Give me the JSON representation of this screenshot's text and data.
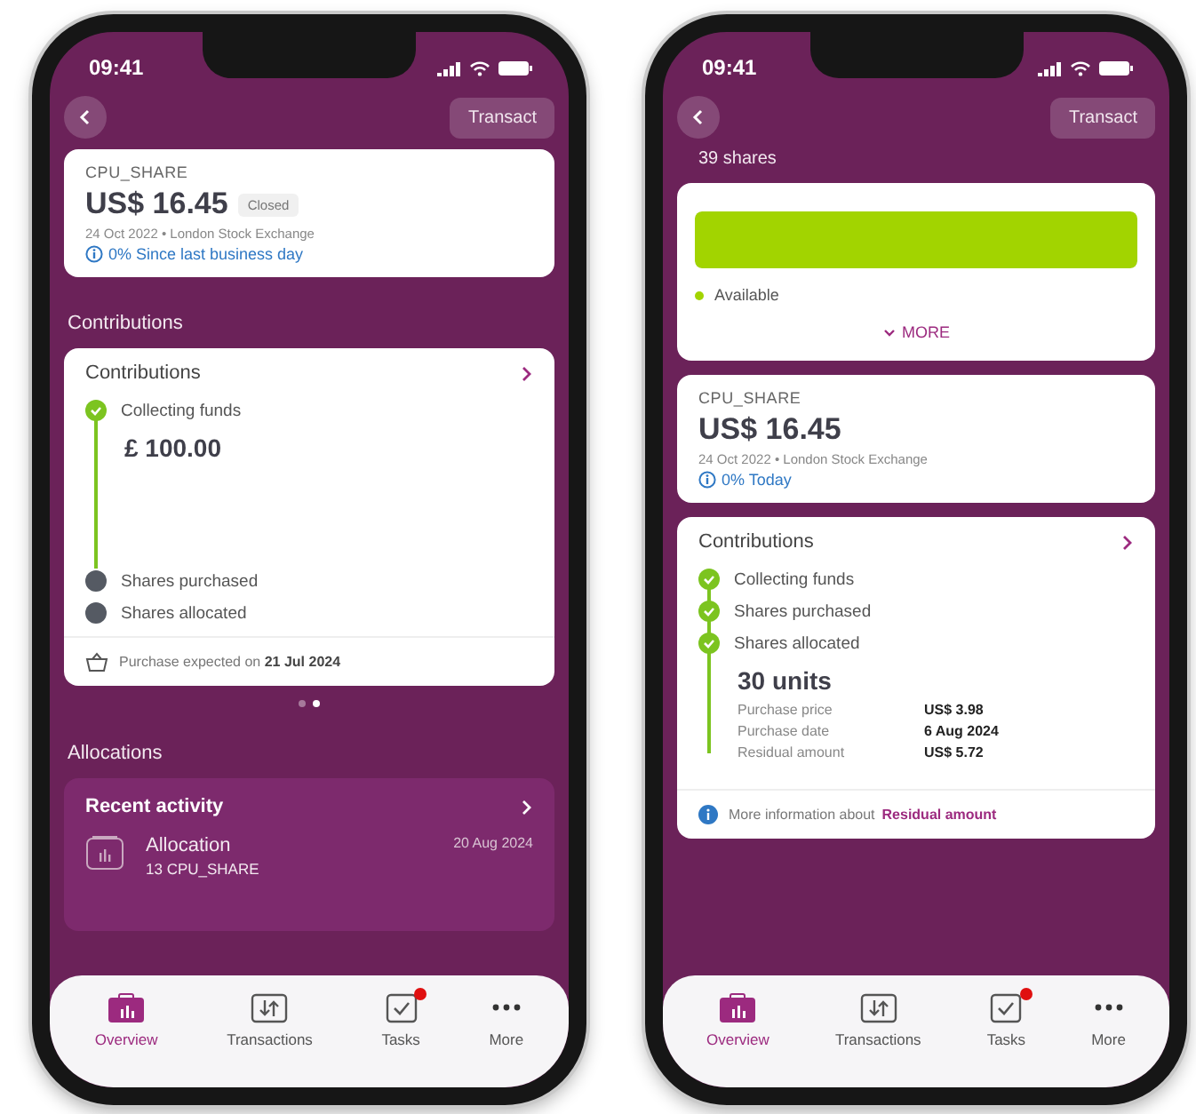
{
  "phones": [
    {
      "status": {
        "time": "09:41"
      },
      "header": {
        "action": "Transact"
      },
      "blocks": [
        {
          "kind": "price",
          "symbol": "CPU_SHARE",
          "price": "US$ 16.45",
          "badge": "Closed",
          "meta": "24 Oct 2022 • London Stock Exchange",
          "change": "0% Since last business day"
        },
        {
          "kind": "heading",
          "text": "Contributions"
        },
        {
          "kind": "contributions",
          "title": "Contributions",
          "steps": [
            {
              "label": "Collecting funds",
              "done": true,
              "detail": "£ 100.00"
            },
            {
              "label": "Shares purchased",
              "done": false
            },
            {
              "label": "Shares allocated",
              "done": false
            }
          ],
          "footer": {
            "kind": "basket",
            "text": "Purchase expected on **21 Jul 2024**"
          }
        },
        {
          "kind": "pager",
          "dots": [
            {
              "selected": false
            },
            {
              "selected": true
            }
          ]
        },
        {
          "kind": "heading",
          "text": "Allocations"
        },
        {
          "kind": "activity",
          "title": "Recent activity",
          "item": {
            "title": "Allocation",
            "date": "20 Aug 2024",
            "subtitle": "13 CPU_SHARE"
          }
        }
      ],
      "nav": [
        {
          "label": "Overview",
          "kind": "overview",
          "selected": true,
          "alert": false
        },
        {
          "label": "Transactions",
          "kind": "transactions",
          "selected": false,
          "alert": false
        },
        {
          "label": "Tasks",
          "kind": "tasks",
          "selected": false,
          "alert": true
        },
        {
          "label": "More",
          "kind": "more",
          "selected": false,
          "alert": false
        }
      ]
    },
    {
      "status": {
        "time": "09:41"
      },
      "header": {
        "action": "Transact"
      },
      "blocks": [
        {
          "kind": "subheading",
          "text": "39 shares"
        },
        {
          "kind": "availability",
          "level": 1,
          "legend": "Available",
          "more": "MORE"
        },
        {
          "kind": "price",
          "symbol": "CPU_SHARE",
          "price": "US$ 16.45",
          "meta": "24 Oct 2022 • London Stock Exchange",
          "change": "0% Today"
        },
        {
          "kind": "contributions",
          "title": "Contributions",
          "steps": [
            {
              "label": "Collecting funds",
              "done": true
            },
            {
              "label": "Shares purchased",
              "done": true
            },
            {
              "label": "Shares allocated",
              "done": true,
              "detail": "30 units"
            }
          ],
          "details": [
            {
              "label": "Purchase price",
              "value": "US$ 3.98"
            },
            {
              "label": "Purchase date",
              "value": "6 Aug 2024"
            },
            {
              "label": "Residual amount",
              "value": "US$ 5.72"
            }
          ],
          "footer": {
            "kind": "info",
            "text": "More information about",
            "link": "Residual amount"
          }
        }
      ],
      "nav": [
        {
          "label": "Overview",
          "kind": "overview",
          "selected": true,
          "alert": false
        },
        {
          "label": "Transactions",
          "kind": "transactions",
          "selected": false,
          "alert": false
        },
        {
          "label": "Tasks",
          "kind": "tasks",
          "selected": false,
          "alert": true
        },
        {
          "label": "More",
          "kind": "more",
          "selected": false,
          "alert": false
        }
      ]
    }
  ]
}
